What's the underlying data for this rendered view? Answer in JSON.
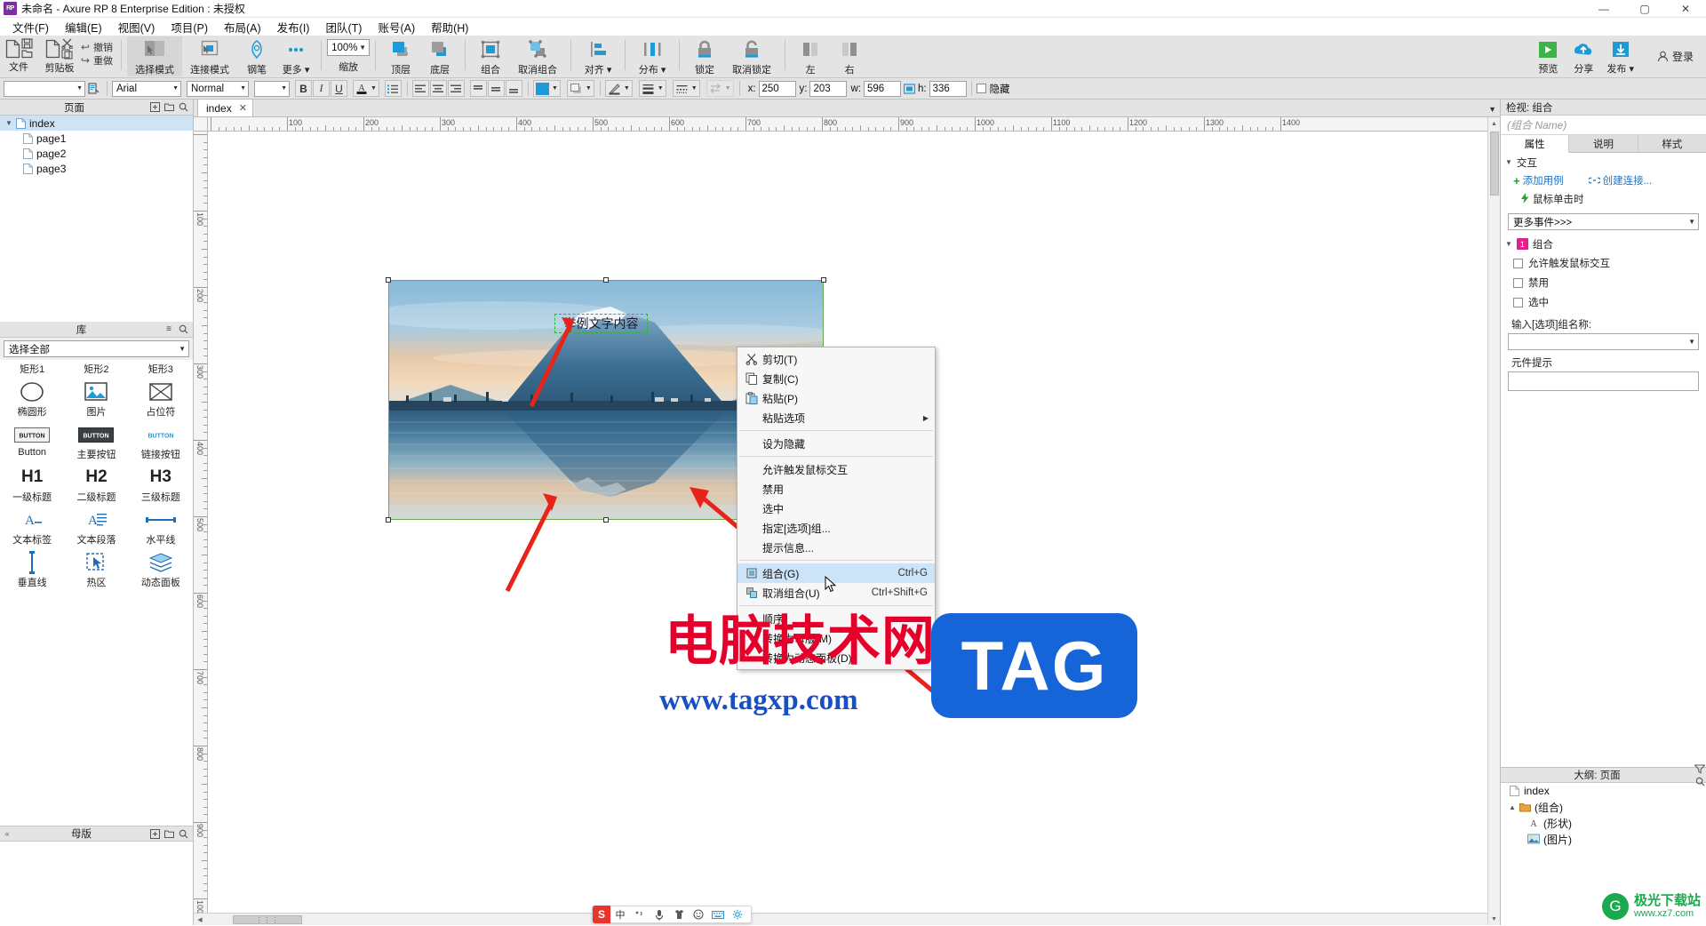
{
  "window": {
    "title": "未命名 - Axure RP 8 Enterprise Edition : 未授权",
    "logo": "RP",
    "minimize": "—",
    "maximize": "▢",
    "close": "✕"
  },
  "menubar": {
    "items": [
      {
        "label": "文件(F)"
      },
      {
        "label": "编辑(E)"
      },
      {
        "label": "视图(V)"
      },
      {
        "label": "项目(P)"
      },
      {
        "label": "布局(A)"
      },
      {
        "label": "发布(I)"
      },
      {
        "label": "团队(T)"
      },
      {
        "label": "账号(A)"
      },
      {
        "label": "帮助(H)"
      }
    ]
  },
  "ribbon": {
    "file_label": "文件",
    "clipboard_label": "剪贴板",
    "undo_label": "撤销",
    "redo_label": "重做",
    "select_mode": "选择模式",
    "connect_mode": "连接模式",
    "pen": "钢笔",
    "more": "更多 ▾",
    "zoom_value": "100%",
    "zoom_label": "缩放",
    "front": "顶层",
    "back": "底层",
    "group": "组合",
    "ungroup": "取消组合",
    "align": "对齐 ▾",
    "distribute": "分布 ▾",
    "lock": "锁定",
    "unlock": "取消锁定",
    "left": "左",
    "right": "右",
    "preview": "预览",
    "share": "分享",
    "publish": "发布 ▾",
    "login": "登录"
  },
  "formatbar": {
    "widget_style_value": "",
    "font_family": "Arial",
    "font_style": "Normal",
    "font_size": "",
    "bold": "B",
    "italic": "I",
    "underline": "U",
    "font_color": "A",
    "list": "≔",
    "x_label": "x:",
    "x_value": "250",
    "y_label": "y:",
    "y_value": "203",
    "w_label": "w:",
    "w_value": "596",
    "h_label": "h:",
    "h_value": "336",
    "hidden_label": "隐藏"
  },
  "pages_panel": {
    "title": "页面",
    "items": [
      {
        "label": "index",
        "level": 0,
        "selected": true
      },
      {
        "label": "page1",
        "level": 1,
        "selected": false
      },
      {
        "label": "page2",
        "level": 1,
        "selected": false
      },
      {
        "label": "page3",
        "level": 1,
        "selected": false
      }
    ]
  },
  "library_panel": {
    "title": "库",
    "selector_value": "选择全部",
    "top_row": [
      "矩形1",
      "矩形2",
      "矩形3"
    ],
    "items": [
      {
        "name": "椭圆形",
        "icon": "ellipse-icon"
      },
      {
        "name": "图片",
        "icon": "image-icon"
      },
      {
        "name": "占位符",
        "icon": "placeholder-icon"
      },
      {
        "name": "Button",
        "icon": "button-icon"
      },
      {
        "name": "主要按钮",
        "icon": "primary-button-icon"
      },
      {
        "name": "链接按钮",
        "icon": "link-button-icon"
      },
      {
        "name": "一级标题",
        "icon": "h1-icon"
      },
      {
        "name": "二级标题",
        "icon": "h2-icon"
      },
      {
        "name": "三级标题",
        "icon": "h3-icon"
      },
      {
        "name": "文本标签",
        "icon": "text-label-icon"
      },
      {
        "name": "文本段落",
        "icon": "paragraph-icon"
      },
      {
        "name": "水平线",
        "icon": "hline-icon"
      },
      {
        "name": "垂直线",
        "icon": "vline-icon"
      },
      {
        "name": "热区",
        "icon": "hotspot-icon"
      },
      {
        "name": "动态面板",
        "icon": "dynamic-panel-icon"
      }
    ],
    "glyphs": [
      "H1",
      "H2",
      "H3",
      "BUTTON",
      "BUTTON",
      "BUTTON"
    ]
  },
  "masters_panel": {
    "title": "母版"
  },
  "canvas": {
    "tab_label": "index",
    "tab_close": "✕",
    "h_ruler_labels": [
      "100",
      "200",
      "300",
      "400",
      "500",
      "600",
      "700",
      "800",
      "900",
      "1000",
      "1100",
      "1200",
      "1300"
    ],
    "v_ruler_labels": [
      "100",
      "200",
      "300",
      "400",
      "500",
      "600",
      "700",
      "800",
      "900"
    ],
    "text_widget": "举例文字内容",
    "scroll_grip": "⋮⋮⋮"
  },
  "context_menu": {
    "items": [
      {
        "label": "剪切(T)",
        "accel": "",
        "icon": "scissors-icon",
        "type": "item"
      },
      {
        "label": "复制(C)",
        "accel": "",
        "icon": "copy-icon",
        "type": "item"
      },
      {
        "label": "粘贴(P)",
        "accel": "",
        "icon": "paste-icon",
        "type": "item"
      },
      {
        "label": "粘贴选项",
        "accel": "",
        "icon": "",
        "type": "submenu"
      },
      {
        "type": "separator"
      },
      {
        "label": "设为隐藏",
        "accel": "",
        "icon": "",
        "type": "item"
      },
      {
        "type": "separator"
      },
      {
        "label": "允许触发鼠标交互",
        "accel": "",
        "icon": "",
        "type": "item"
      },
      {
        "label": "禁用",
        "accel": "",
        "icon": "",
        "type": "item"
      },
      {
        "label": "选中",
        "accel": "",
        "icon": "",
        "type": "item"
      },
      {
        "label": "指定[选项]组...",
        "accel": "",
        "icon": "",
        "type": "item"
      },
      {
        "label": "提示信息...",
        "accel": "",
        "icon": "",
        "type": "item"
      },
      {
        "type": "separator"
      },
      {
        "label": "组合(G)",
        "accel": "Ctrl+G",
        "icon": "group-icon",
        "type": "item",
        "highlighted": true
      },
      {
        "label": "取消组合(U)",
        "accel": "Ctrl+Shift+G",
        "icon": "ungroup-icon",
        "type": "item"
      },
      {
        "type": "separator"
      },
      {
        "label": "顺序",
        "accel": "",
        "icon": "",
        "type": "submenu"
      },
      {
        "label": "转换为母版(M)",
        "accel": "",
        "icon": "",
        "type": "item"
      },
      {
        "label": "转换为动态面板(D)",
        "accel": "",
        "icon": "",
        "type": "item"
      }
    ]
  },
  "inspector": {
    "header": "检视: 组合",
    "name_placeholder": "(组合 Name)",
    "tabs": [
      {
        "label": "属性",
        "active": true
      },
      {
        "label": "说明",
        "active": false
      },
      {
        "label": "样式",
        "active": false
      }
    ],
    "interaction_section": "交互",
    "add_case": "添加用例",
    "create_link": "创建连接...",
    "event_mouse_click": "鼠标单击时",
    "more_events": "更多事件>>>",
    "group_section": "组合",
    "group_badge": "1",
    "checkboxes": [
      {
        "label": "允许触发鼠标交互"
      },
      {
        "label": "禁用"
      },
      {
        "label": "选中"
      }
    ],
    "group_name_label": "输入[选项]组名称:",
    "group_name_value": "",
    "tooltip_label": "元件提示",
    "tooltip_value": ""
  },
  "outline": {
    "title": "大纲: 页面",
    "items": [
      {
        "label": "index",
        "level": 0,
        "icon": "page-icon"
      },
      {
        "label": "(组合)",
        "level": 1,
        "icon": "group-folder-icon"
      },
      {
        "label": "(形状)",
        "level": 2,
        "icon": "shape-A-icon"
      },
      {
        "label": "(图片)",
        "level": 2,
        "icon": "image-icon"
      }
    ]
  },
  "ime": {
    "logo": "S",
    "lang": "中",
    "items": [
      "✎",
      "🎤",
      "👕",
      "☺",
      "⌨",
      "⚙"
    ]
  },
  "watermarks": {
    "cn_text": "电脑技术网",
    "url_text": "www.tagxp.com",
    "tag_text": "TAG",
    "jg_title": "极光下载站",
    "jg_sub": "www.xz7.com",
    "jg_icon": "G"
  },
  "colors": {
    "accent": "#1e9bd7",
    "selection": "#cfe3f5",
    "highlight": "#cde3f7",
    "badge": "#e0218a",
    "link": "#1a72c4",
    "green": "#2aa02a",
    "red_arrow": "#e8231c"
  }
}
